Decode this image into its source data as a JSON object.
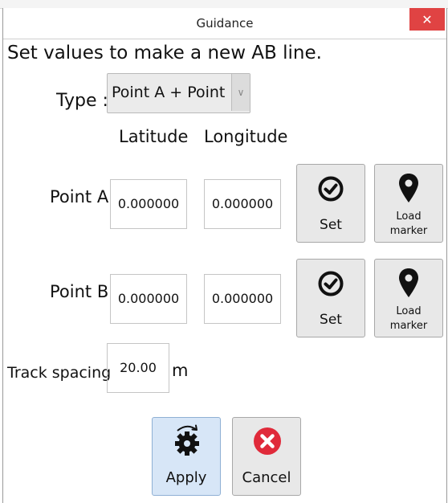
{
  "window": {
    "title": "Guidance",
    "close_label": "✕"
  },
  "heading": "Set values to make a new AB line.",
  "type": {
    "label": "Type :",
    "value": "Point A + Point B"
  },
  "columns": {
    "latitude": "Latitude",
    "longitude": "Longitude"
  },
  "point_a": {
    "label": "Point A",
    "latitude": "0.000000",
    "longitude": "0.000000",
    "set_label": "Set",
    "load_label_1": "Load",
    "load_label_2": "marker"
  },
  "point_b": {
    "label": "Point B",
    "latitude": "0.000000",
    "longitude": "0.000000",
    "set_label": "Set",
    "load_label_1": "Load",
    "load_label_2": "marker"
  },
  "spacing": {
    "label": "Track spacing",
    "value": "20.00",
    "unit": "m"
  },
  "actions": {
    "apply_label": "Apply",
    "cancel_label": "Cancel"
  },
  "colors": {
    "close_bg": "#e04343",
    "cancel_icon": "#e02a3a",
    "apply_bg": "#d7e6f7",
    "button_bg": "#e8e8e8"
  }
}
